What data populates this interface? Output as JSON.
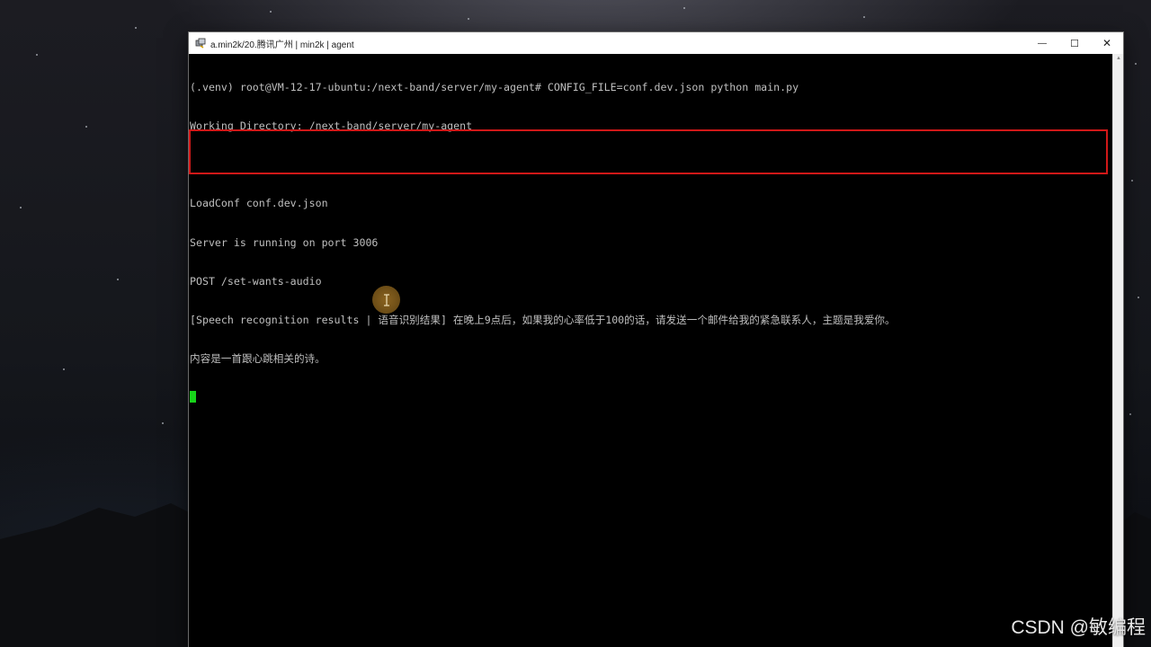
{
  "window": {
    "title": "a.min2k/20.腾讯广州 | min2k | agent",
    "controls": {
      "minimize": "—",
      "maximize": "☐",
      "close": "✕"
    }
  },
  "terminal": {
    "lines": [
      "(.venv) root@VM-12-17-ubuntu:/next-band/server/my-agent# CONFIG_FILE=conf.dev.json python main.py",
      "Working Directory: /next-band/server/my-agent",
      "",
      "LoadConf conf.dev.json",
      "Server is running on port 3006",
      "POST /set-wants-audio",
      "[Speech recognition results | 语音识别结果] 在晚上9点后，如果我的心率低于100的话，请发送一个邮件给我的紧急联系人，主题是我爱你。",
      "内容是一首跟心跳相关的诗。"
    ]
  },
  "watermark": "CSDN @敏编程",
  "colors": {
    "highlight": "#d01818",
    "cursor": "#17d31a",
    "terminal_text": "#bfbfbf",
    "terminal_bg": "#000000"
  },
  "icons": {
    "app": "putty-terminal-icon",
    "mouse": "text-cursor-icon"
  }
}
